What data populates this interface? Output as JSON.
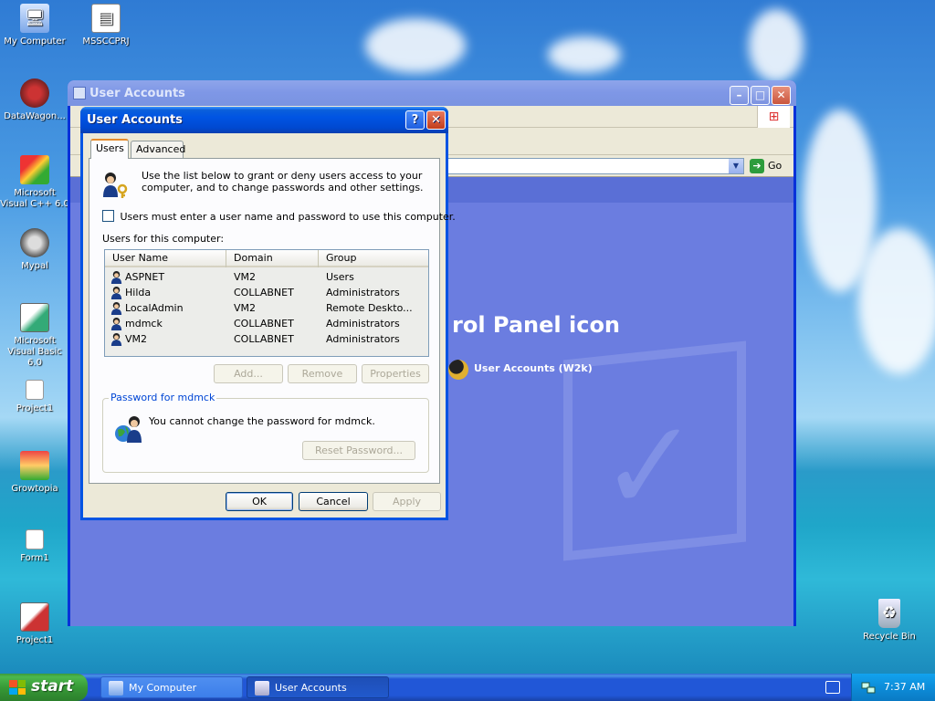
{
  "desktop": {
    "icons": [
      {
        "label": "My Computer",
        "icon": "computer-icon"
      },
      {
        "label": "MSSCCPRJ",
        "icon": "document-icon"
      },
      {
        "label": "DataWagon...",
        "icon": "app-icon"
      },
      {
        "label": "Microsoft Visual C++ 6.0",
        "icon": "vc-icon"
      },
      {
        "label": "Mypal",
        "icon": "browser-icon"
      },
      {
        "label": "Microsoft Visual Basic 6.0",
        "icon": "vb-icon"
      },
      {
        "label": "Project1",
        "icon": "folder-icon"
      },
      {
        "label": "Growtopia",
        "icon": "game-icon"
      },
      {
        "label": "Form1",
        "icon": "folder-icon"
      },
      {
        "label": "Project1",
        "icon": "project-icon"
      },
      {
        "label": "Recycle Bin",
        "icon": "recycle-bin-icon"
      }
    ]
  },
  "background_window": {
    "title": "User Accounts",
    "go_label": "Go",
    "heading": "rol Panel icon",
    "link_label": "User Accounts (W2k)"
  },
  "dialog": {
    "title": "User Accounts",
    "help_glyph": "?",
    "close_glyph": "✕",
    "tabs": [
      {
        "label": "Users",
        "active": true
      },
      {
        "label": "Advanced",
        "active": false
      }
    ],
    "intro_text": "Use the list below to grant or deny users access to your computer, and to change passwords and other settings.",
    "require_login_label": "Users must enter a user name and password to use this computer.",
    "require_login_checked": false,
    "users_label": "Users for this computer:",
    "columns": [
      "User Name",
      "Domain",
      "Group"
    ],
    "users": [
      {
        "name": "ASPNET",
        "domain": "VM2",
        "group": "Users"
      },
      {
        "name": "Hilda",
        "domain": "COLLABNET",
        "group": "Administrators"
      },
      {
        "name": "LocalAdmin",
        "domain": "VM2",
        "group": "Remote Deskto..."
      },
      {
        "name": "mdmck",
        "domain": "COLLABNET",
        "group": "Administrators"
      },
      {
        "name": "VM2",
        "domain": "COLLABNET",
        "group": "Administrators"
      }
    ],
    "list_buttons": {
      "add": "Add...",
      "remove": "Remove",
      "properties": "Properties"
    },
    "password_group": {
      "legend": "Password for mdmck",
      "text": "You cannot change the password for mdmck.",
      "reset_label": "Reset Password..."
    },
    "footer": {
      "ok": "OK",
      "cancel": "Cancel",
      "apply": "Apply"
    }
  },
  "taskbar": {
    "start_label": "start",
    "tasks": [
      {
        "label": "My Computer",
        "active": false
      },
      {
        "label": "User Accounts",
        "active": true
      }
    ],
    "clock": "7:37 AM"
  },
  "colors": {
    "xp_blue": "#0054e3",
    "start_green": "#3c9a3c",
    "tab_accent": "#e68b2c",
    "cp_content": "#6b7de0"
  }
}
